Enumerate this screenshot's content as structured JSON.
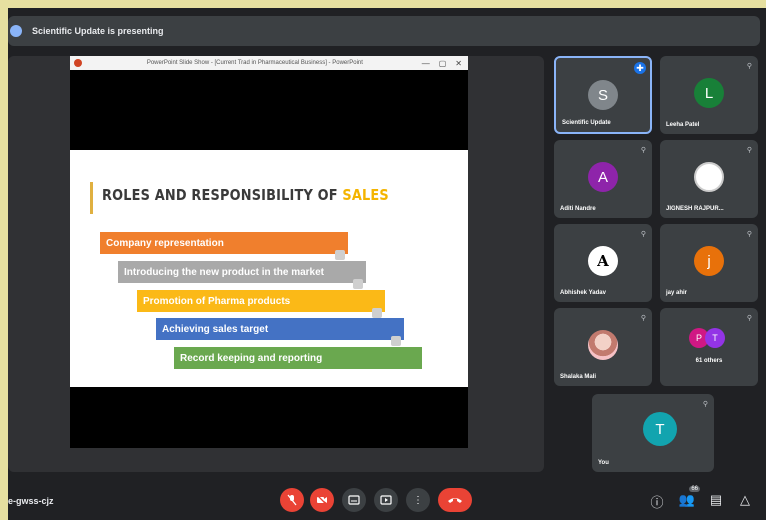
{
  "topbar": {
    "text": "Scientific Update is presenting"
  },
  "presentation": {
    "window_title": "PowerPoint Slide Show - [Current Trad in Pharmaceutical Business] - PowerPoint",
    "slide": {
      "heading_part1": "ROLES AND RESPONSIBILITY OF ",
      "heading_highlight": "SALES",
      "steps": [
        {
          "label": "Company  representation",
          "color": "#f07f2d"
        },
        {
          "label": "Introducing the new product in the market",
          "color": "#a9a9a9"
        },
        {
          "label": "Promotion of Pharma products",
          "color": "#fbb917"
        },
        {
          "label": "Achieving sales target",
          "color": "#4472c4"
        },
        {
          "label": "Record keeping and reporting",
          "color": "#6aa84f"
        }
      ]
    }
  },
  "participants": [
    {
      "name": "Scientific Update",
      "initial": "S",
      "color": "#80868b",
      "active": true
    },
    {
      "name": "Leeha Patel",
      "initial": "L",
      "color": "#188038"
    },
    {
      "name": "Aditi Nandre",
      "initial": "A",
      "color": "#8e24aa"
    },
    {
      "name": "JIGNESH RAJPUR...",
      "initial": "",
      "color": "#ffffff"
    },
    {
      "name": "Abhishek Yadav",
      "initial": "A",
      "color": "#ffffff"
    },
    {
      "name": "jay ahir",
      "initial": "j",
      "color": "#e8710a"
    },
    {
      "name": "Shalaka Mali",
      "initial": "",
      "color": "#f6c1c5"
    },
    {
      "name": "61 others",
      "initial": "",
      "color": ""
    },
    {
      "name": "You",
      "initial": "T",
      "color": "#12a4af"
    }
  ],
  "others_avatars": [
    {
      "initial": "P",
      "color": "#d01884"
    },
    {
      "initial": "T",
      "color": "#9334e6"
    }
  ],
  "bottom": {
    "meeting_code": "e-gwss-cjz",
    "people_count": "66"
  },
  "icons": {
    "mic": "mic-off-icon",
    "camera": "camera-off-icon",
    "captions": "captions-icon",
    "present": "present-icon",
    "more": "more-options-icon",
    "end": "end-call-icon",
    "info": "info-icon",
    "people": "people-icon",
    "chat": "chat-icon",
    "activities": "activities-icon"
  }
}
